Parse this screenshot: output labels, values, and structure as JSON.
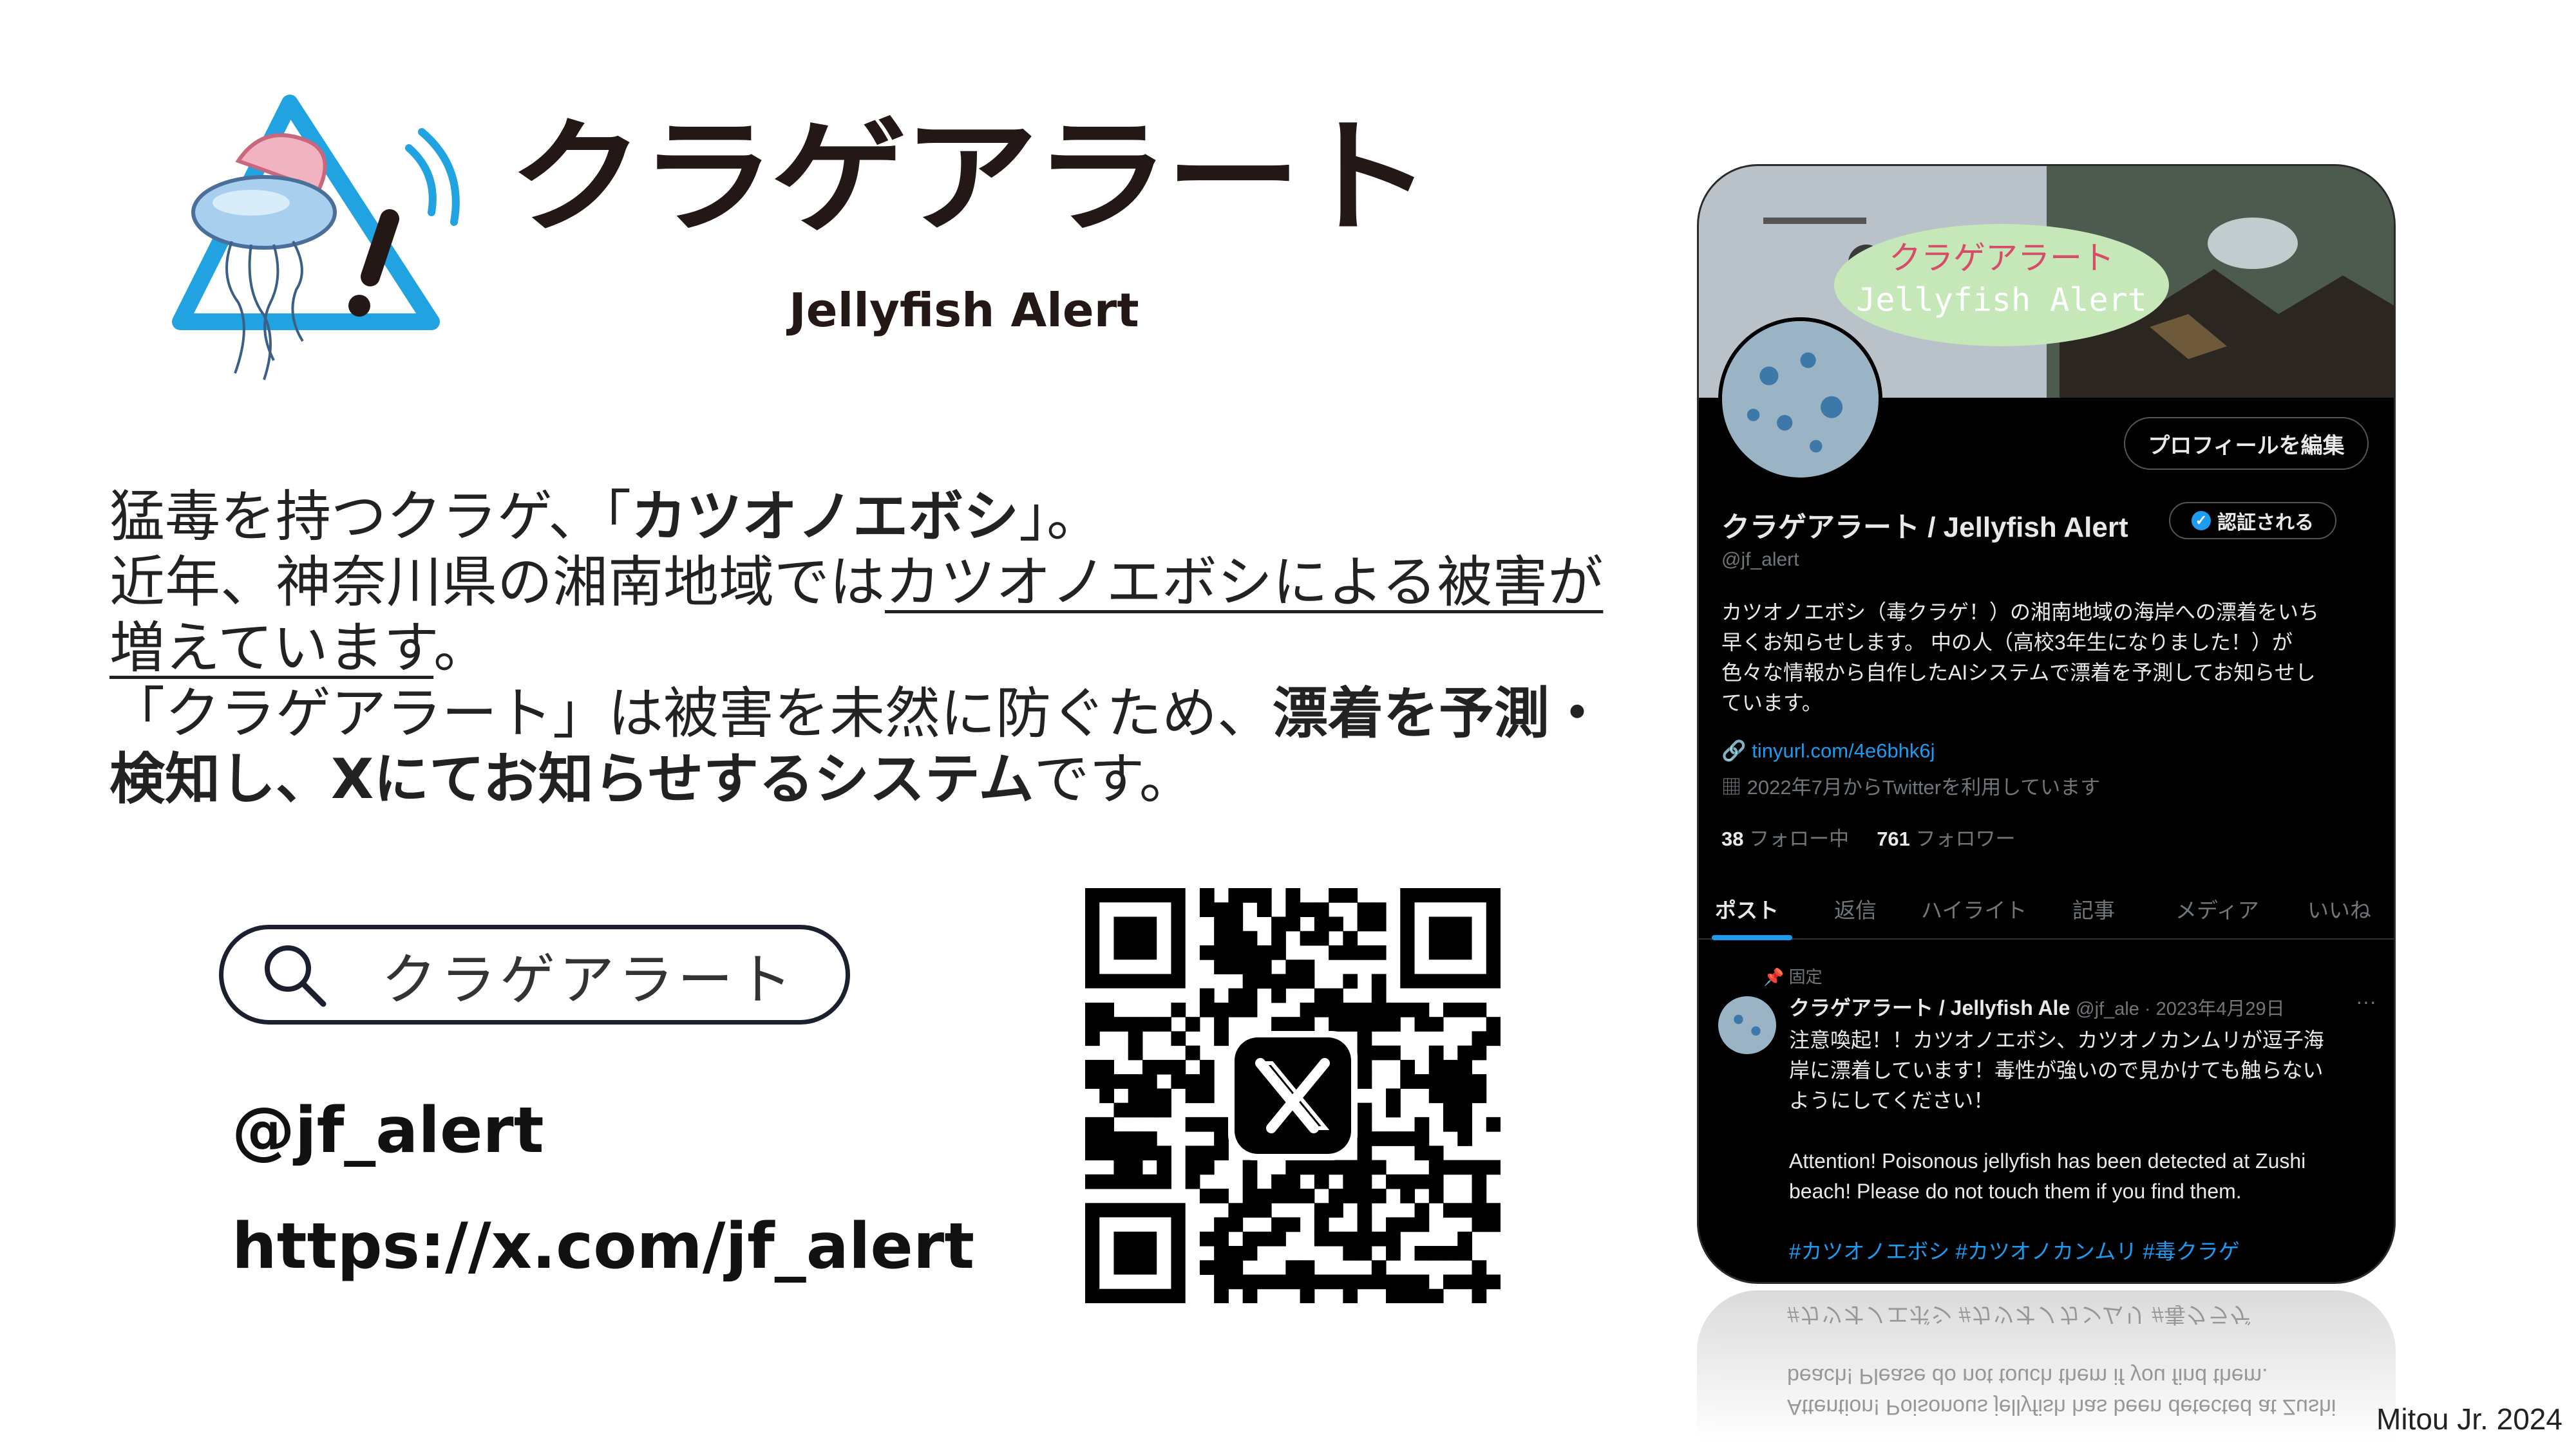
{
  "colors": {
    "accent_blue": "#1d9bf0",
    "logo_blue": "#20a3e0",
    "dark": "#231815",
    "x_black": "#000000"
  },
  "logo": {
    "title": "クラゲアラート",
    "subtitle": "Jellyfish Alert"
  },
  "description": {
    "l1_a": "猛毒を持つクラゲ、「",
    "l1_b": "カツオノエボシ",
    "l1_c": "」。",
    "l2_a": "近年、神奈川県の湘南地域では",
    "l2_b": "カツオノエボシによる被害が",
    "l3_a": "増えています",
    "l3_b": "。",
    "l4_a": "「クラゲアラート」は被害を未然に防ぐため、",
    "l4_b": "漂着を予測・",
    "l5_a": "検知し、Xにてお知らせするシステム",
    "l5_b": "です。"
  },
  "search": {
    "icon": "search-icon",
    "text": "クラゲアラート"
  },
  "handle": "@jf_alert",
  "url": "https://x.com/jf_alert",
  "qr": {
    "center_icon": "x-logo-icon"
  },
  "profile": {
    "banner_text_1": "クラゲアラート",
    "banner_text_2": "Jellyfish Alert",
    "edit_button": "プロフィールを編集",
    "display_name": "クラゲアラート / Jellyfish Alert",
    "verified_label": "認証される",
    "handle": "@jf_alert",
    "bio_1": "カツオノエボシ（毒クラゲ！）の湘南地域の海岸への漂着をいち",
    "bio_2": "早くお知らせします。 中の人（高校3年生になりました！）が",
    "bio_3": "色々な情報から自作したAIシステムで漂着を予測してお知らせし",
    "bio_4": "ています。",
    "link": "tinyurl.com/4e6bhk6j",
    "joined": "2022年7月からTwitterを利用しています",
    "following_count": "38",
    "following_label": "フォロー中",
    "followers_count": "761",
    "followers_label": "フォロワー",
    "tabs": [
      "ポスト",
      "返信",
      "ハイライト",
      "記事",
      "メディア",
      "いいね"
    ]
  },
  "tweet": {
    "pinned": "固定",
    "name": "クラゲアラート / Jellyfish Ale",
    "meta": "@jf_ale · 2023年4月29日",
    "more": "···",
    "jp_1": "注意喚起！！カツオノエボシ、カツオノカンムリが逗子海",
    "jp_2": "岸に漂着しています！毒性が強いので見かけても触らない",
    "jp_3": "ようにしてください！",
    "en_1": "Attention! Poisonous jellyfish has been detected at Zushi",
    "en_2": "beach! Please do not touch them if you find them.",
    "tags": "#カツオノエボシ #カツオノカンムリ #毒クラゲ"
  },
  "credit": "Mitou Jr. 2024"
}
